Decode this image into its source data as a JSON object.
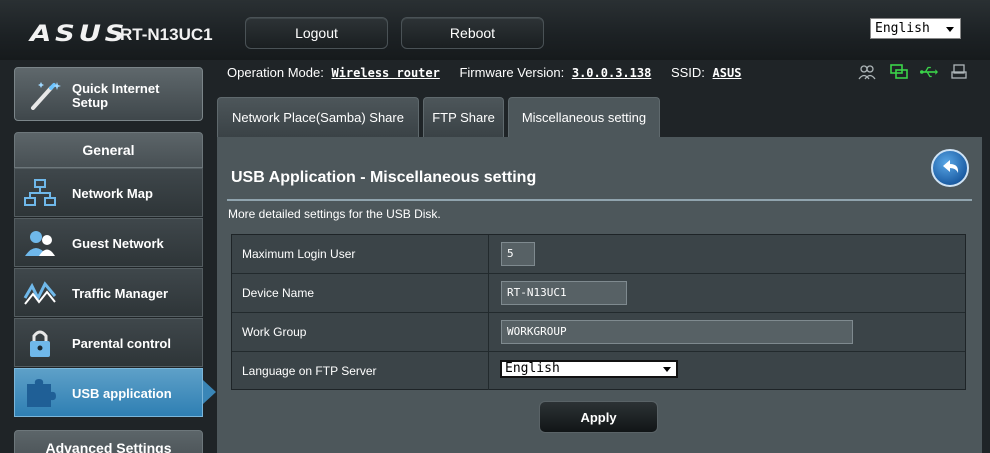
{
  "header": {
    "brand": "ASUS",
    "model": "RT-N13UC1",
    "logout_label": "Logout",
    "reboot_label": "Reboot",
    "language": "English"
  },
  "status": {
    "operation_mode_label": "Operation Mode:",
    "operation_mode_value": "Wireless router",
    "firmware_label": "Firmware Version:",
    "firmware_value": "3.0.0.3.138",
    "ssid_label": "SSID:",
    "ssid_value": "ASUS",
    "icons": [
      "clients-icon",
      "network-icon",
      "usb-icon",
      "printer-icon"
    ]
  },
  "sidebar": {
    "quick_setup_label": "Quick Internet Setup",
    "general_header": "General",
    "items": [
      {
        "label": "Network Map",
        "icon": "network-map-icon"
      },
      {
        "label": "Guest Network",
        "icon": "guest-network-icon"
      },
      {
        "label": "Traffic Manager",
        "icon": "traffic-manager-icon"
      },
      {
        "label": "Parental control",
        "icon": "lock-icon"
      },
      {
        "label": "USB application",
        "icon": "puzzle-icon",
        "active": true
      }
    ],
    "advanced_header": "Advanced Settings"
  },
  "tabs": [
    {
      "label": "Network Place(Samba) Share"
    },
    {
      "label": "FTP Share"
    },
    {
      "label": "Miscellaneous setting",
      "active": true
    }
  ],
  "panel": {
    "title": "USB Application - Miscellaneous setting",
    "description": "More detailed settings for the USB Disk.",
    "rows": [
      {
        "label": "Maximum Login User",
        "value": "5"
      },
      {
        "label": "Device Name",
        "value": "RT-N13UC1"
      },
      {
        "label": "Work Group",
        "value": "WORKGROUP"
      },
      {
        "label": "Language on FTP Server",
        "value": "English"
      }
    ],
    "apply_label": "Apply"
  },
  "colors": {
    "accent": "#2f7fb3",
    "panel_bg": "#4d575b",
    "status_icon_green": "#3bd44a"
  }
}
